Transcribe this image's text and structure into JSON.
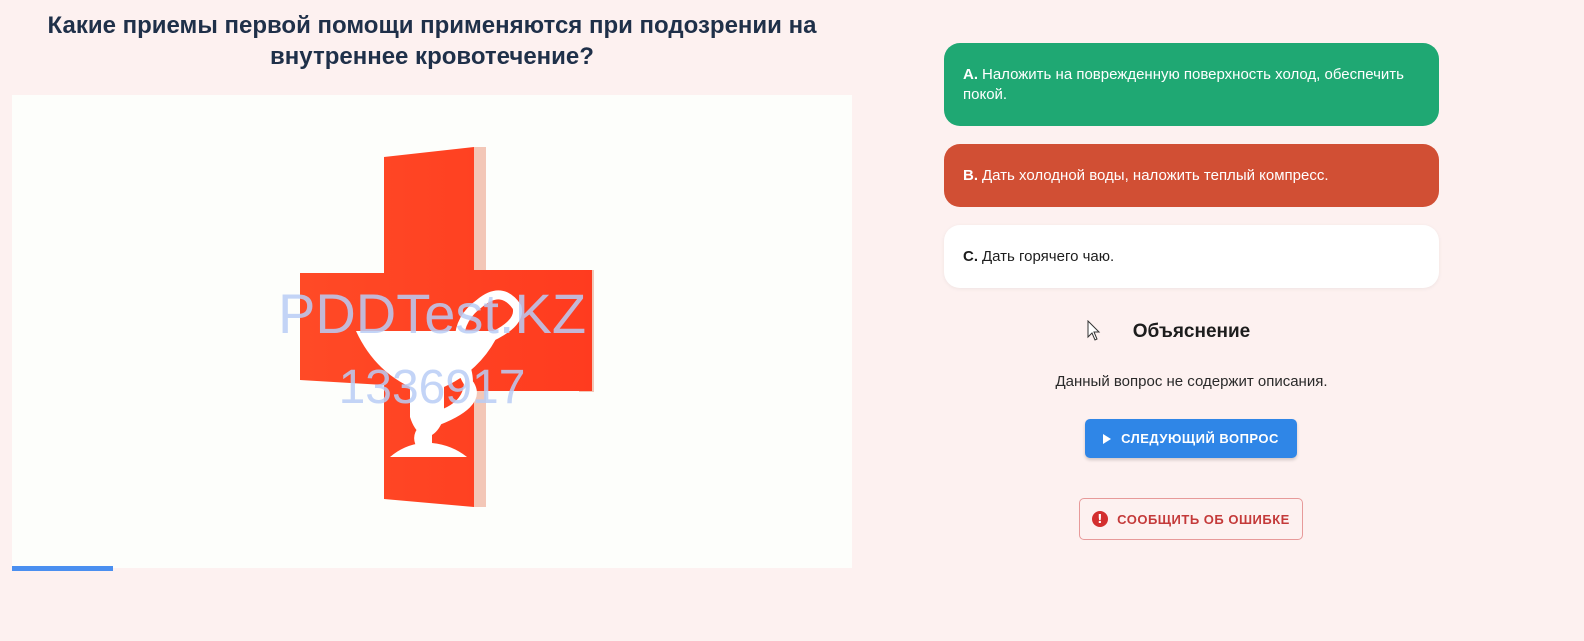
{
  "question": {
    "title": "Какие приемы первой помощи применяются при подозрении на внутреннее кровотечение?"
  },
  "image": {
    "watermark_line1": "PDDTest.KZ",
    "watermark_line2": "1336917",
    "cross_color": "#ff4524",
    "watermark_color": "#b9cdf6"
  },
  "progress": {
    "fraction": 0.12,
    "color": "#4a8ff0"
  },
  "answers": [
    {
      "letter": "A.",
      "text": "Наложить на поврежденную поверхность холод, обеспечить покой.",
      "state": "correct",
      "color": "#1fa873"
    },
    {
      "letter": "B.",
      "text": "Дать холодной воды, наложить теплый компресс.",
      "state": "wrong",
      "color": "#d14f34"
    },
    {
      "letter": "C.",
      "text": "Дать горячего чаю.",
      "state": "neutral",
      "color": "#ffffff"
    }
  ],
  "explanation": {
    "title": "Объяснение",
    "text": "Данный вопрос не содержит описания."
  },
  "buttons": {
    "next_label": "СЛЕДУЮЩИЙ ВОПРОС",
    "next_icon": "play-icon",
    "report_label": "СООБЩИТЬ ОБ ОШИБКЕ",
    "report_icon": "alert-circle-icon"
  }
}
